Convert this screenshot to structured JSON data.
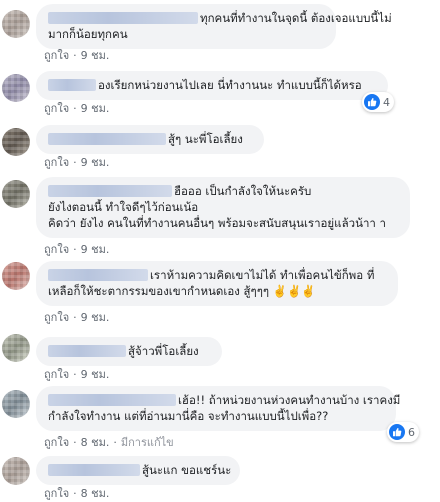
{
  "comments": [
    {
      "lines": [
        "ทุกคนที่ทำงานในจุดนี้ ต้องเจอแบบนี้ไม่",
        "มากก็น้อยทุกคน"
      ],
      "like_label": "ถูกใจ",
      "time": "9 ชม.",
      "edited": "",
      "reaction_count": ""
    },
    {
      "lines": [
        "องเรียกหน่วยงานไปเลย นี่ทำงานนะ ทำแบบนี้ก็ได้หรอ"
      ],
      "like_label": "ถูกใจ",
      "time": "9 ชม.",
      "edited": "",
      "reaction_count": "4"
    },
    {
      "lines": [
        "สู้ๆ นะพี่โอเลี้ยง"
      ],
      "like_label": "ถูกใจ",
      "time": "9 ชม.",
      "edited": "",
      "reaction_count": ""
    },
    {
      "lines": [
        "ฮือออ เป็นกำลังใจให้นะครับ",
        "ยังไงตอนนี้ ทำใจดีๆไว้ก่อนเน้อ",
        "คิดว่า ยังไง คนในที่ทำงานคนอื่นๆ พร้อมจะสนับสนุนเราอยู่แล้วน้าา า"
      ],
      "like_label": "ถูกใจ",
      "time": "9 ชม.",
      "edited": "",
      "reaction_count": ""
    },
    {
      "lines": [
        "เราห้ามความคิดเขาไม่ได้ ทำเพื่อคนไข้ก็พอ ที่",
        "เหลือก็ให้ชะตากรรมของเขากำหนดเอง สู้ๆๆๆ ✌️✌️✌️"
      ],
      "like_label": "ถูกใจ",
      "time": "9 ชม.",
      "edited": "",
      "reaction_count": ""
    },
    {
      "lines": [
        "สู้จ้าวพี่โอเลี้ยง"
      ],
      "like_label": "ถูกใจ",
      "time": "9 ชม.",
      "edited": "",
      "reaction_count": ""
    },
    {
      "lines": [
        "เฮ้อ!! ถ้าหน่วยงานห่วงคนทำงานบ้าง เราคงมี",
        "กำลังใจทำงาน แต่ที่อ่านมานี่คือ จะทำงานแบบนี้ไปเพื่อ??"
      ],
      "like_label": "ถูกใจ",
      "time": "8 ชม.",
      "edited": "มีการแก้ไข",
      "reaction_count": "6"
    },
    {
      "lines": [
        "สู้นะแก ขอแชร์นะ"
      ],
      "like_label": "ถูกใจ",
      "time": "8 ชม.",
      "edited": "",
      "reaction_count": ""
    }
  ],
  "colors": {
    "bubble": "#f2f3f5",
    "meta_text": "#606770",
    "like_blue": "#1877f2"
  },
  "icons": {
    "reaction": "thumbs-up-icon"
  }
}
